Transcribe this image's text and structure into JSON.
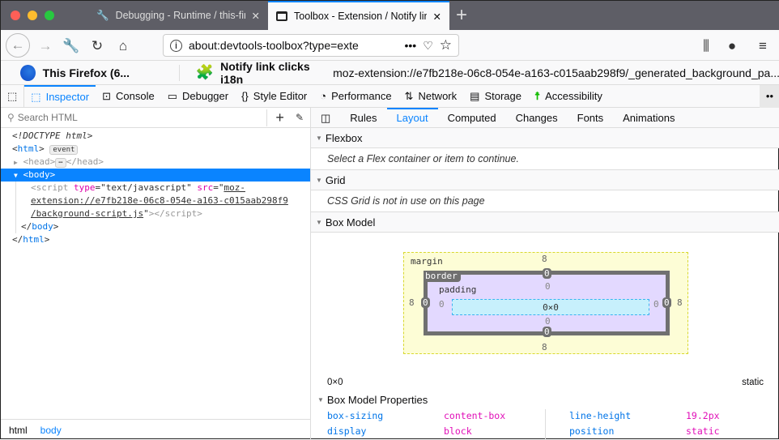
{
  "browser": {
    "tabs": [
      {
        "label": "Debugging - Runtime / this-firef",
        "icon": "wrench-icon"
      },
      {
        "label": "Toolbox - Extension / Notify link",
        "icon": "window-icon"
      }
    ],
    "url": "about:devtools-toolbox?type=exte"
  },
  "target": {
    "runtime": "This Firefox (6...",
    "extension_name": "Notify link clicks i18n",
    "extension_url": "moz-extension://e7fb218e-06c8-054e-a163-c015aab298f9/_generated_background_pa..."
  },
  "devtools_tabs": [
    {
      "label": "Inspector",
      "icon": "inspector-icon"
    },
    {
      "label": "Console",
      "icon": "console-icon"
    },
    {
      "label": "Debugger",
      "icon": "debugger-icon"
    },
    {
      "label": "Style Editor",
      "icon": "braces-icon"
    },
    {
      "label": "Performance",
      "icon": "gauge-icon"
    },
    {
      "label": "Network",
      "icon": "network-icon"
    },
    {
      "label": "Storage",
      "icon": "storage-icon"
    },
    {
      "label": "Accessibility",
      "icon": "accessibility-icon"
    }
  ],
  "inspector": {
    "search_placeholder": "Search HTML",
    "doctype": "<!DOCTYPE html>",
    "event_badge": "event",
    "script_src_1": "moz-",
    "script_src_2": "extension://e7fb218e-06c8-054e-a163-c015aab298f9",
    "script_src_3": "/background-script.js",
    "breadcrumb": [
      "html",
      "body"
    ]
  },
  "sidebar": {
    "tabs": [
      "Rules",
      "Layout",
      "Computed",
      "Changes",
      "Fonts",
      "Animations"
    ],
    "flexbox": {
      "title": "Flexbox",
      "message": "Select a Flex container or item to continue."
    },
    "grid": {
      "title": "Grid",
      "message": "CSS Grid is not in use on this page"
    },
    "boxmodel": {
      "title": "Box Model",
      "margin_label": "margin",
      "border_label": "border",
      "padding_label": "padding",
      "margin": {
        "top": "8",
        "right": "8",
        "bottom": "8",
        "left": "8"
      },
      "border": {
        "top": "0",
        "right": "0",
        "bottom": "0",
        "left": "0"
      },
      "padding": {
        "top": "0",
        "right": "0",
        "bottom": "0",
        "left": "0"
      },
      "content": "0×0",
      "size": "0×0",
      "position": "static"
    },
    "props_title": "Box Model Properties",
    "props": [
      {
        "name": "box-sizing",
        "value": "content-box"
      },
      {
        "name": "display",
        "value": "block"
      },
      {
        "name": "line-height",
        "value": "19.2px"
      },
      {
        "name": "position",
        "value": "static"
      }
    ]
  },
  "colors": {
    "accent": "#0a84ff",
    "attr": "#dd00a9"
  }
}
